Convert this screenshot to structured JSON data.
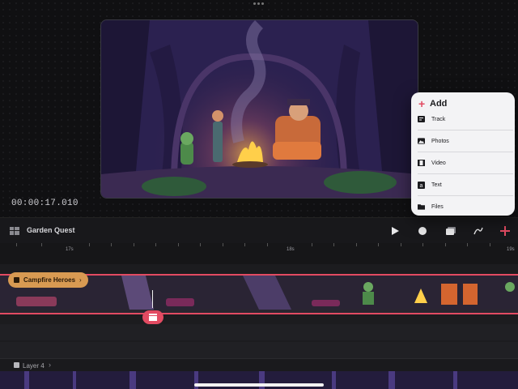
{
  "preview": {
    "timecode": "00:00:17.010"
  },
  "toolbar": {
    "project_title": "Garden Quest",
    "buttons": [
      "play-icon",
      "record-icon",
      "layers-icon",
      "draw-icon",
      "add-icon"
    ]
  },
  "ruler": {
    "labels": [
      "17s",
      "18s",
      "19s"
    ]
  },
  "timeline": {
    "scene_chip": "Campfire Heroes",
    "layer_label": "Layer 4"
  },
  "add_menu": {
    "title": "Add",
    "items": [
      {
        "label": "Track",
        "icon": "track-icon"
      },
      {
        "label": "Photos",
        "icon": "photos-icon"
      },
      {
        "label": "Video",
        "icon": "video-icon"
      },
      {
        "label": "Text",
        "icon": "text-icon"
      },
      {
        "label": "Files",
        "icon": "folder-icon"
      }
    ]
  },
  "colors": {
    "accent": "#e24b62",
    "chip": "#d89a52",
    "background": "#111113"
  }
}
